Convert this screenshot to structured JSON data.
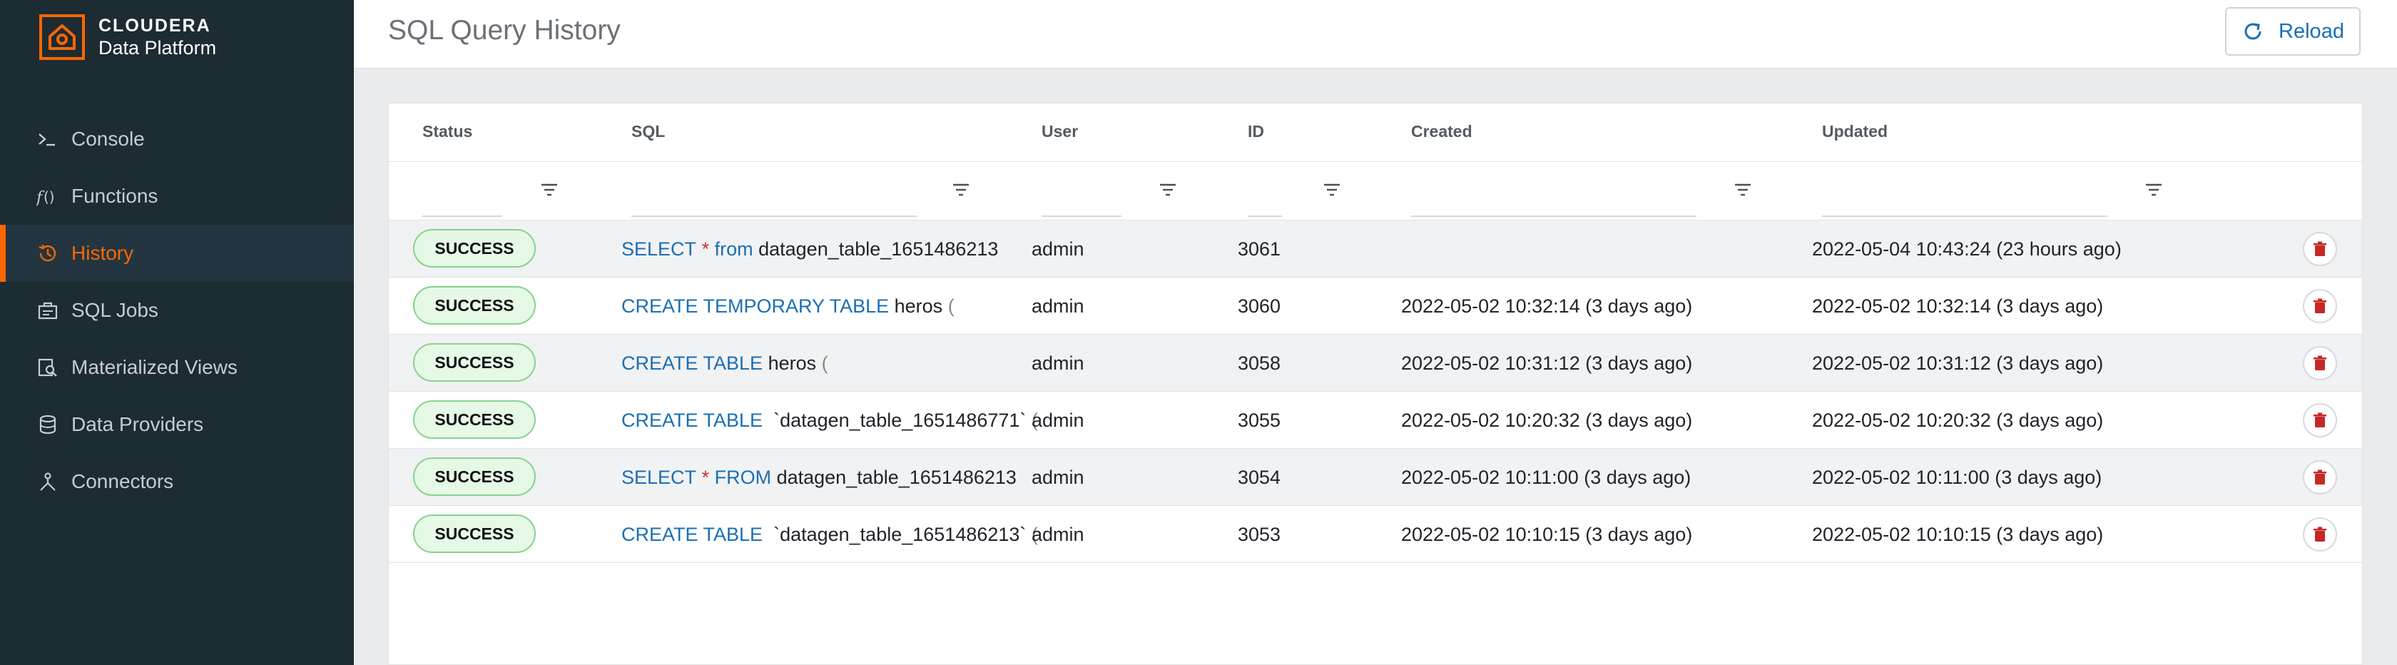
{
  "brand": {
    "name": "CLOUDERA",
    "subtitle": "Data Platform"
  },
  "sidebar": {
    "items": [
      {
        "label": "Console",
        "icon": "console-icon"
      },
      {
        "label": "Functions",
        "icon": "function-icon"
      },
      {
        "label": "History",
        "icon": "history-clock-icon",
        "active": true
      },
      {
        "label": "SQL Jobs",
        "icon": "jobs-icon"
      },
      {
        "label": "Materialized Views",
        "icon": "materialized-views-icon"
      },
      {
        "label": "Data Providers",
        "icon": "data-providers-icon"
      },
      {
        "label": "Connectors",
        "icon": "connectors-icon"
      }
    ]
  },
  "header": {
    "title": "SQL Query History",
    "reload_label": "Reload"
  },
  "table": {
    "columns": [
      "Status",
      "SQL",
      "User",
      "ID",
      "Created",
      "Updated"
    ],
    "rows": [
      {
        "status": "SUCCESS",
        "sql": {
          "kw": "SELECT",
          "op": "*",
          "kw2": "from",
          "rest": "datagen_table_1651486213",
          "tail": ""
        },
        "user": "admin",
        "id": "3061",
        "created": "",
        "updated": "2022-05-04 10:43:24 (23 hours ago)"
      },
      {
        "status": "SUCCESS",
        "sql": {
          "kw": "CREATE TEMPORARY TABLE",
          "op": "",
          "kw2": "",
          "rest": "heros",
          "tail": "("
        },
        "user": "admin",
        "id": "3060",
        "created": "2022-05-02 10:32:14 (3 days ago)",
        "updated": "2022-05-02 10:32:14 (3 days ago)"
      },
      {
        "status": "SUCCESS",
        "sql": {
          "kw": "CREATE TABLE",
          "op": "",
          "kw2": "",
          "rest": "heros",
          "tail": "("
        },
        "user": "admin",
        "id": "3058",
        "created": "2022-05-02 10:31:12 (3 days ago)",
        "updated": "2022-05-02 10:31:12 (3 days ago)"
      },
      {
        "status": "SUCCESS",
        "sql": {
          "kw": "CREATE TABLE",
          "op": "",
          "kw2": "",
          "rest": " `datagen_table_1651486771`",
          "tail": "("
        },
        "user": "admin",
        "id": "3055",
        "created": "2022-05-02 10:20:32 (3 days ago)",
        "updated": "2022-05-02 10:20:32 (3 days ago)"
      },
      {
        "status": "SUCCESS",
        "sql": {
          "kw": "SELECT",
          "op": "*",
          "kw2": "FROM",
          "rest": "datagen_table_1651486213",
          "tail": ""
        },
        "user": "admin",
        "id": "3054",
        "created": "2022-05-02 10:11:00 (3 days ago)",
        "updated": "2022-05-02 10:11:00 (3 days ago)"
      },
      {
        "status": "SUCCESS",
        "sql": {
          "kw": "CREATE TABLE",
          "op": "",
          "kw2": "",
          "rest": " `datagen_table_1651486213`",
          "tail": "("
        },
        "user": "admin",
        "id": "3053",
        "created": "2022-05-02 10:10:15 (3 days ago)",
        "updated": "2022-05-02 10:10:15 (3 days ago)"
      }
    ]
  },
  "colors": {
    "accent": "#f96702",
    "link": "#1a6fb5",
    "sidebar_bg": "#1d2b33",
    "success_bg": "#e6f8e6",
    "success_border": "#86d38e",
    "delete": "#c62828"
  }
}
